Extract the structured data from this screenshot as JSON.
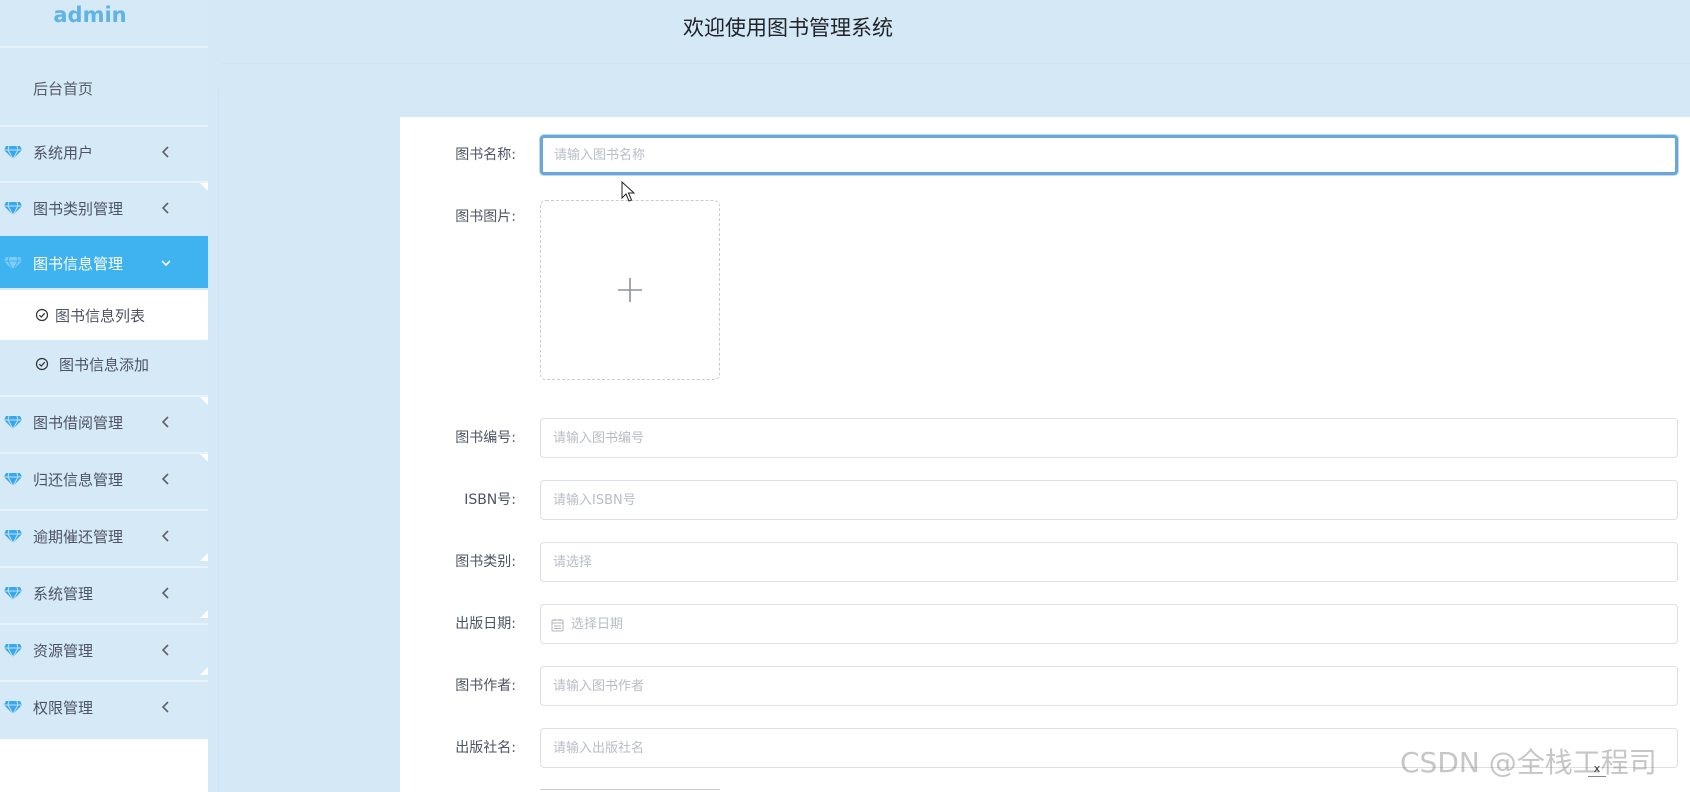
{
  "app": {
    "brand": "admin",
    "title": "欢迎使用图书管理系统"
  },
  "sidebar": {
    "home": "后台首页",
    "menu": [
      {
        "label": "系统用户",
        "icon": "gem-icon",
        "state": "collapsed"
      },
      {
        "label": "图书类别管理",
        "icon": "gem-icon",
        "state": "collapsed"
      },
      {
        "label": "图书信息管理",
        "icon": "gem-icon",
        "state": "expanded"
      },
      {
        "label": "图书借阅管理",
        "icon": "gem-icon",
        "state": "collapsed"
      },
      {
        "label": "归还信息管理",
        "icon": "gem-icon",
        "state": "collapsed"
      },
      {
        "label": "逾期催还管理",
        "icon": "gem-icon",
        "state": "collapsed"
      },
      {
        "label": "系统管理",
        "icon": "gem-icon",
        "state": "collapsed"
      },
      {
        "label": "资源管理",
        "icon": "gem-icon",
        "state": "collapsed"
      },
      {
        "label": "权限管理",
        "icon": "gem-icon",
        "state": "collapsed"
      }
    ],
    "submenu": [
      {
        "label": "图书信息列表",
        "icon": "check-circle-icon",
        "current": true
      },
      {
        "label": "图书信息添加",
        "icon": "check-circle-icon",
        "current": false
      }
    ]
  },
  "form": {
    "name": {
      "label": "图书名称:",
      "placeholder": "请输入图书名称"
    },
    "image": {
      "label": "图书图片:",
      "icon": "plus-icon"
    },
    "number": {
      "label": "图书编号:",
      "placeholder": "请输入图书编号"
    },
    "isbn": {
      "label": "ISBN号:",
      "placeholder": "请输入ISBN号"
    },
    "category": {
      "label": "图书类别:",
      "placeholder": "请选择"
    },
    "date": {
      "label": "出版日期:",
      "placeholder": "选择日期",
      "icon": "calendar-icon"
    },
    "author": {
      "label": "图书作者:",
      "placeholder": "请输入图书作者"
    },
    "publisher": {
      "label": "出版社名:",
      "placeholder": "请输入出版社名"
    }
  },
  "watermark": "CSDN @全栈工程司",
  "close_mark": "x",
  "colors": {
    "background": "#d5e8f6",
    "active_menu": "#3fb2f0",
    "brand": "#5fb3e6",
    "focus_border": "#6aa7d8"
  }
}
